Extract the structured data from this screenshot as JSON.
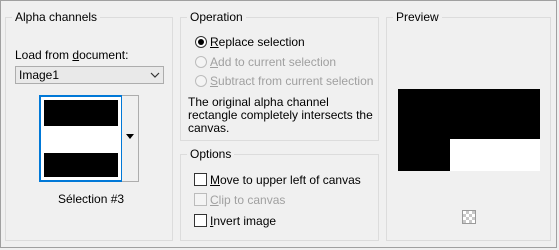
{
  "alpha_channels": {
    "title": "Alpha channels",
    "load_label_pre": "Load from ",
    "load_label_u": "d",
    "load_label_post": "ocument:",
    "document_selected": "Image1",
    "selection_name": "Sélection #3"
  },
  "operation": {
    "title": "Operation",
    "options": [
      {
        "pre": "",
        "u": "R",
        "post": "eplace selection",
        "selected": true,
        "enabled": true
      },
      {
        "pre": "",
        "u": "A",
        "post": "dd to current selection",
        "selected": false,
        "enabled": false
      },
      {
        "pre": "",
        "u": "S",
        "post": "ubtract from current selection",
        "selected": false,
        "enabled": false
      }
    ],
    "message_line1": "The original alpha channel",
    "message_line2": "rectangle completely intersects the",
    "message_line3": "canvas."
  },
  "options": {
    "title": "Options",
    "items": [
      {
        "pre": "",
        "u": "M",
        "post": "ove to upper left of canvas",
        "checked": false,
        "enabled": true
      },
      {
        "pre": "",
        "u": "C",
        "post": "lip to canvas",
        "checked": false,
        "enabled": false
      },
      {
        "pre": "",
        "u": "I",
        "post": "nvert image",
        "checked": false,
        "enabled": true
      }
    ]
  },
  "preview": {
    "title": "Preview",
    "icon": "checkerboard-icon"
  }
}
